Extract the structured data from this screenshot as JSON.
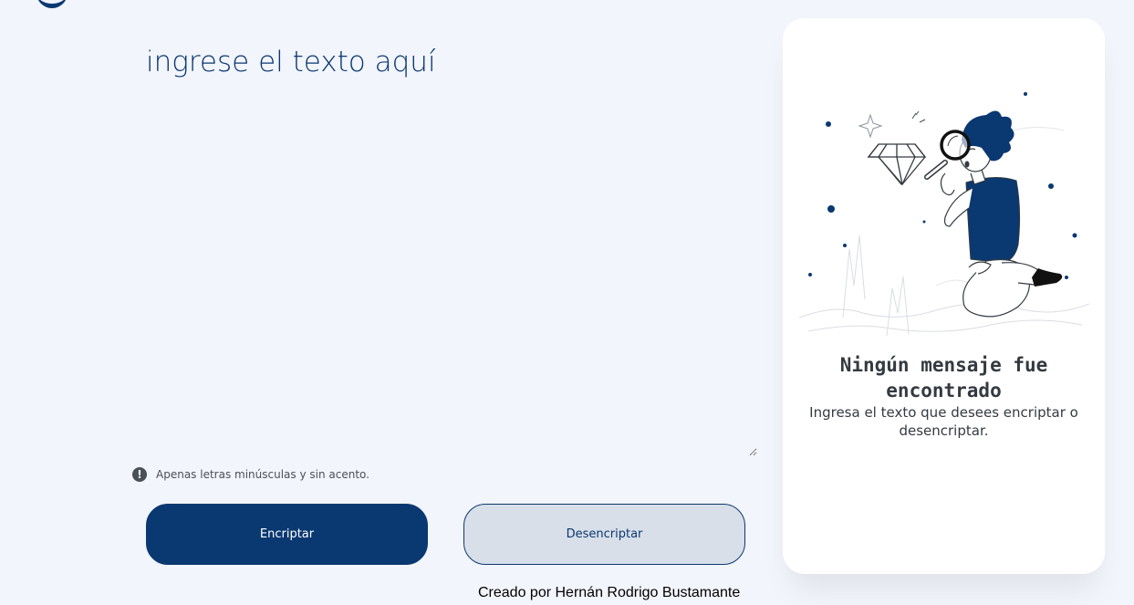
{
  "input": {
    "placeholder": "ingrese el texto aquí",
    "value": ""
  },
  "hint": {
    "icon": "exclamation-circle-icon",
    "text": "Apenas letras minúsculas y sin acento."
  },
  "buttons": {
    "encrypt_label": "Encriptar",
    "decrypt_label": "Desencriptar"
  },
  "footer": {
    "credit": "Creado por Hernán Rodrigo Bustamante"
  },
  "result": {
    "illustration": "boy-with-magnifying-glass-illustration",
    "title": "Ningún mensaje fue encontrado",
    "text": "Ingresa el texto que desees encriptar o desencriptar."
  },
  "colors": {
    "background": "#f3f5fc",
    "primary": "#0a3871",
    "secondary_bg": "#d8dfe8",
    "card": "#ffffff",
    "text_dark": "#343a40"
  }
}
